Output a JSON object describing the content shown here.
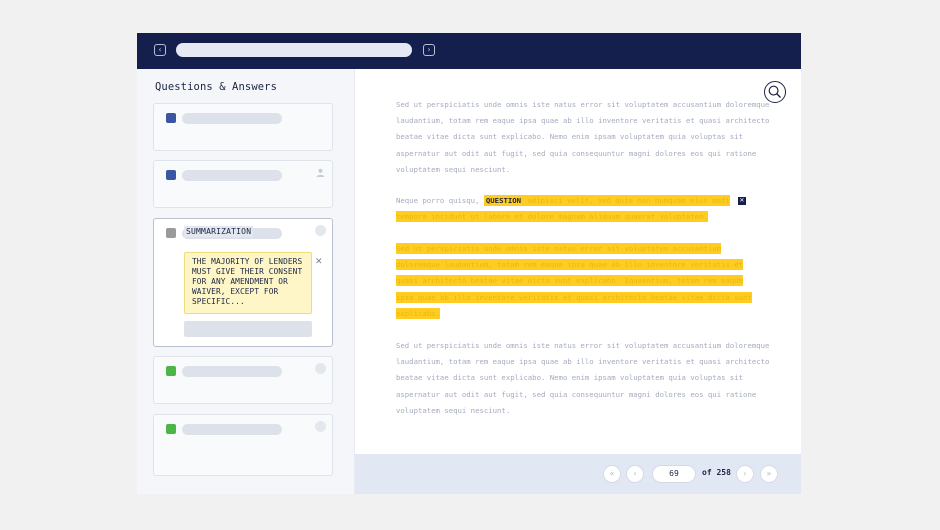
{
  "sidebar": {
    "title": "Questions & Answers",
    "summary_label": "SUMMARIZATION",
    "summary_text": "THE MAJORITY OF LENDERS MUST GIVE THEIR CONSENT FOR ANY AMENDMENT OR WAIVER, EXCEPT FOR SPECIFIC..."
  },
  "document": {
    "para1": "Sed ut perspiciatis unde omnis iste natus error sit voluptatem accusantium doloremque laudantium, totam rem eaque ipsa quae ab illo inventore veritatis et quasi architecto beatae vitae dicta sunt explicabo. Nemo enim ipsam voluptatem quia voluptas sit aspernatur aut odit aut fugit, sed quia consequuntur magni dolores eos qui ratione voluptatem sequi nesciunt.",
    "para2_lead": "Neque porro quisqu,",
    "question_tag": "QUESTION",
    "para2_hl_a": " adipisci velit, sed quia non numquam eius modi",
    "para2_hl_b": "tempora incidunt ut labore et dolore magnam aliquam quaerat voluptatem.",
    "para3_l1": "Sed ut perspiciatis unde omnis iste natus error sit voluptatem accusantium",
    "para3_l2": "doloremque laudantium, totam rem eaque ipsa quae ab illo inventore veritatis et",
    "para3_l3": "quasi architecto beatae vitae dicta sunt explicabo. Iquaentium, totam rem eaque",
    "para3_l4": "ipsa quae ab illo inventore veritatis et quasi architecto beatae vitae dicta sunt",
    "para3_l5": "explicabo.",
    "para4": "Sed ut perspiciatis unde omnis iste natus error sit voluptatem accusantium doloremque laudantium, totam rem eaque ipsa quae ab illo inventore veritatis et quasi architecto beatae vitae dicta sunt explicabo. Nemo enim ipsam voluptatem quia voluptas sit aspernatur aut odit aut fugit, sed quia consequuntur magni dolores eos qui ratione voluptatem sequi nesciunt."
  },
  "pagination": {
    "current_page": "69",
    "of_label": "of 258",
    "first": "«",
    "prev": "‹",
    "next": "›",
    "last": "»"
  },
  "colors": {
    "topbar": "#151f4d",
    "highlight": "#ffcc1f",
    "summary_bg": "#fff6c8",
    "blue_marker": "#3a56a3",
    "green_marker": "#4bb548"
  },
  "icons": [
    "chevron-left-icon",
    "chevron-right-icon",
    "search-icon",
    "user-icon",
    "close-icon"
  ]
}
